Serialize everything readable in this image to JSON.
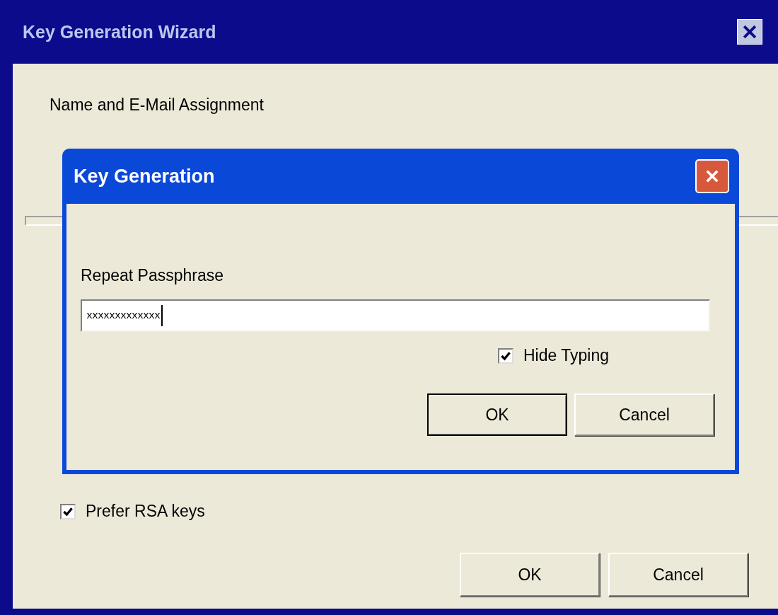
{
  "window": {
    "title": "Key Generation Wizard"
  },
  "wizard": {
    "heading": "Name and E-Mail Assignment",
    "prefer_rsa": {
      "label": "Prefer RSA keys",
      "checked": true
    },
    "buttons": [
      "OK",
      "Cancel"
    ]
  },
  "dialog": {
    "title": "Key Generation",
    "field_label": "Repeat Passphrase",
    "passphrase": "xxxxxxxxxxxxx",
    "hide_typing": {
      "label": "Hide Typing",
      "checked": true
    },
    "buttons": [
      {
        "label": "OK",
        "selected": true
      },
      {
        "label": "Cancel",
        "selected": false
      }
    ]
  }
}
